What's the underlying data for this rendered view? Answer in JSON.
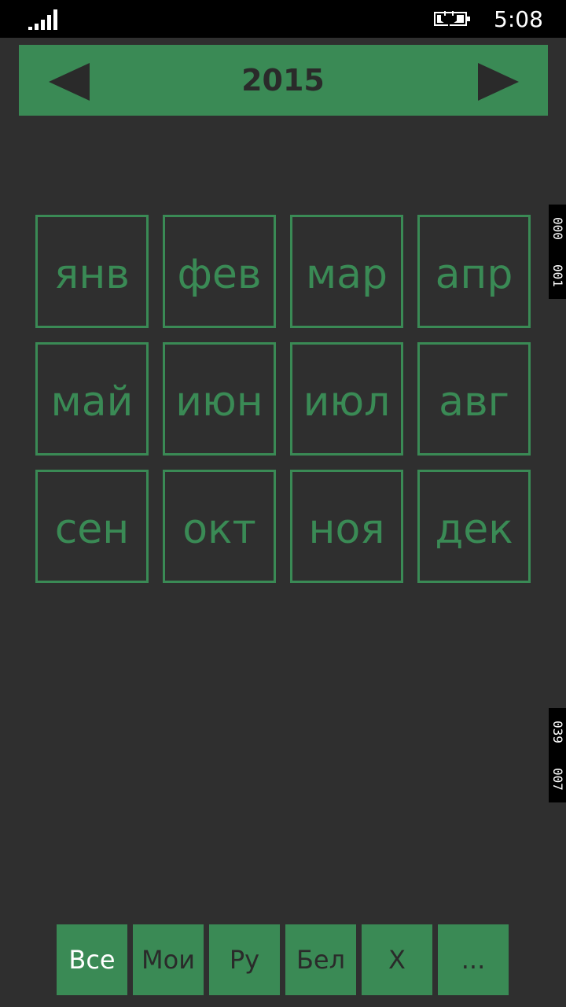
{
  "status_bar": {
    "time": "5:08",
    "signal_icon": "signal-bars-icon",
    "battery_icon": "battery-charging-icon"
  },
  "header": {
    "year": "2015",
    "prev_icon": "triangle-left-icon",
    "next_icon": "triangle-right-icon"
  },
  "months": [
    {
      "label": "янв"
    },
    {
      "label": "фев"
    },
    {
      "label": "мар"
    },
    {
      "label": "апр"
    },
    {
      "label": "май"
    },
    {
      "label": "июн"
    },
    {
      "label": "июл"
    },
    {
      "label": "авг"
    },
    {
      "label": "сен"
    },
    {
      "label": "окт"
    },
    {
      "label": "ноя"
    },
    {
      "label": "дек"
    }
  ],
  "side_counters": [
    {
      "a": "000",
      "b": "001"
    },
    {
      "a": "039",
      "b": "007"
    }
  ],
  "filters": [
    {
      "label": "Все",
      "active": true
    },
    {
      "label": "Мои",
      "active": false
    },
    {
      "label": "Ру",
      "active": false
    },
    {
      "label": "Бел",
      "active": false
    },
    {
      "label": "Х",
      "active": false
    },
    {
      "label": "...",
      "active": false
    }
  ],
  "colors": {
    "accent": "#3a8a55",
    "background": "#2f2f2f",
    "status_bar": "#000000",
    "dark_text": "#2a2a2a"
  }
}
